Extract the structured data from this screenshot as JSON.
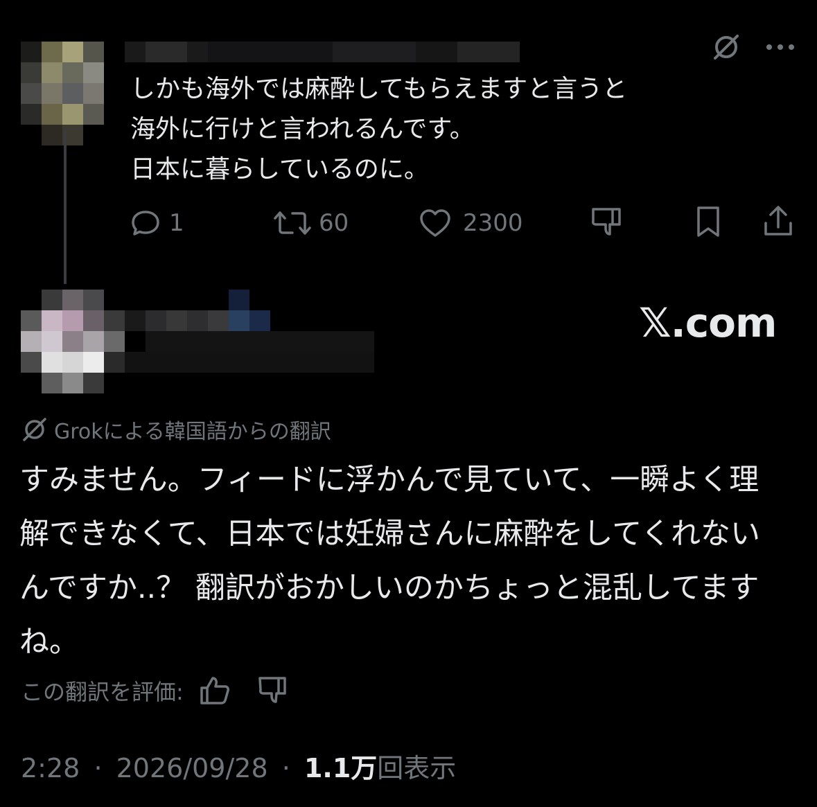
{
  "tweet": {
    "lines": [
      "しかも海外では麻酔してもらえますと言うと",
      "海外に行けと言われるんです。",
      "日本に暮らしているのに。"
    ],
    "replies": "1",
    "reposts": "60",
    "likes": "2300"
  },
  "watermark": "𝕏.com",
  "translation": {
    "header": "Grokによる韓国語からの翻訳",
    "text": "すみません。フィードに浮かんで見ていて、一瞬よく理解できなくて、日本では妊婦さんに麻酔をしてくれないんですか..？ 翻訳がおかしいのかちょっと混乱してますね。",
    "rate_label": "この翻訳を評価:"
  },
  "meta": {
    "time": "2:28",
    "sep1": "·",
    "date": "2026/09/28",
    "sep2": "·",
    "views": "1.1万",
    "views_label": "回表示"
  },
  "colors": {
    "background": "#000000",
    "text": "#e7e9ea",
    "muted": "#71767b"
  },
  "icons": [
    "grok-icon",
    "more-icon",
    "reply-icon",
    "repost-icon",
    "like-icon",
    "dislike-icon",
    "bookmark-icon",
    "share-icon",
    "thumbs-up-icon",
    "thumbs-down-icon"
  ]
}
